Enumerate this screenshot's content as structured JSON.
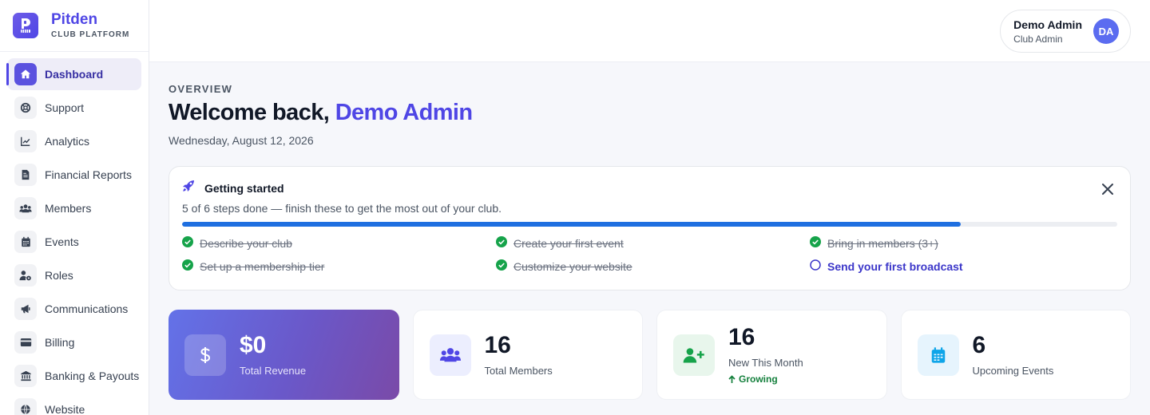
{
  "brand": {
    "name": "Pitden",
    "tagline": "CLUB PLATFORM"
  },
  "sidebar": {
    "items": [
      {
        "label": "Dashboard",
        "icon": "home-icon",
        "active": true
      },
      {
        "label": "Support",
        "icon": "lifebuoy-icon"
      },
      {
        "label": "Analytics",
        "icon": "chart-line-icon"
      },
      {
        "label": "Financial Reports",
        "icon": "file-invoice-icon"
      },
      {
        "label": "Members",
        "icon": "users-icon"
      },
      {
        "label": "Events",
        "icon": "calendar-icon"
      },
      {
        "label": "Roles",
        "icon": "user-cog-icon"
      },
      {
        "label": "Communications",
        "icon": "megaphone-icon"
      },
      {
        "label": "Billing",
        "icon": "credit-card-icon"
      },
      {
        "label": "Banking & Payouts",
        "icon": "bank-icon"
      },
      {
        "label": "Website",
        "icon": "globe-icon"
      }
    ]
  },
  "user": {
    "name": "Demo Admin",
    "role": "Club Admin",
    "initials": "DA"
  },
  "overview": {
    "eyebrow": "OVERVIEW",
    "welcome_prefix": "Welcome back,",
    "welcome_name": "Demo Admin",
    "date": "Wednesday, August 12, 2026"
  },
  "getting_started": {
    "title": "Getting started",
    "subtitle": "5 of 6 steps done — finish these to get the most out of your club.",
    "progress": 0.833,
    "steps": [
      {
        "label": "Describe your club",
        "done": true
      },
      {
        "label": "Create your first event",
        "done": true
      },
      {
        "label": "Bring in members (3+)",
        "done": true
      },
      {
        "label": "Set up a membership tier",
        "done": true
      },
      {
        "label": "Customize your website",
        "done": true
      },
      {
        "label": "Send your first broadcast",
        "done": false
      }
    ]
  },
  "stats": [
    {
      "value": "$0",
      "label": "Total Revenue",
      "icon": "dollar-icon"
    },
    {
      "value": "16",
      "label": "Total Members",
      "icon": "users-icon"
    },
    {
      "value": "16",
      "label": "New This Month",
      "trend": "Growing",
      "icon": "user-plus-icon"
    },
    {
      "value": "6",
      "label": "Upcoming Events",
      "icon": "calendar-icon"
    }
  ],
  "colors": {
    "primary": "#4f46e5",
    "progress": "#1f6fe0",
    "success": "#16a34a",
    "feature_gradient_start": "#6372e8",
    "feature_gradient_end": "#7a4aa8"
  }
}
